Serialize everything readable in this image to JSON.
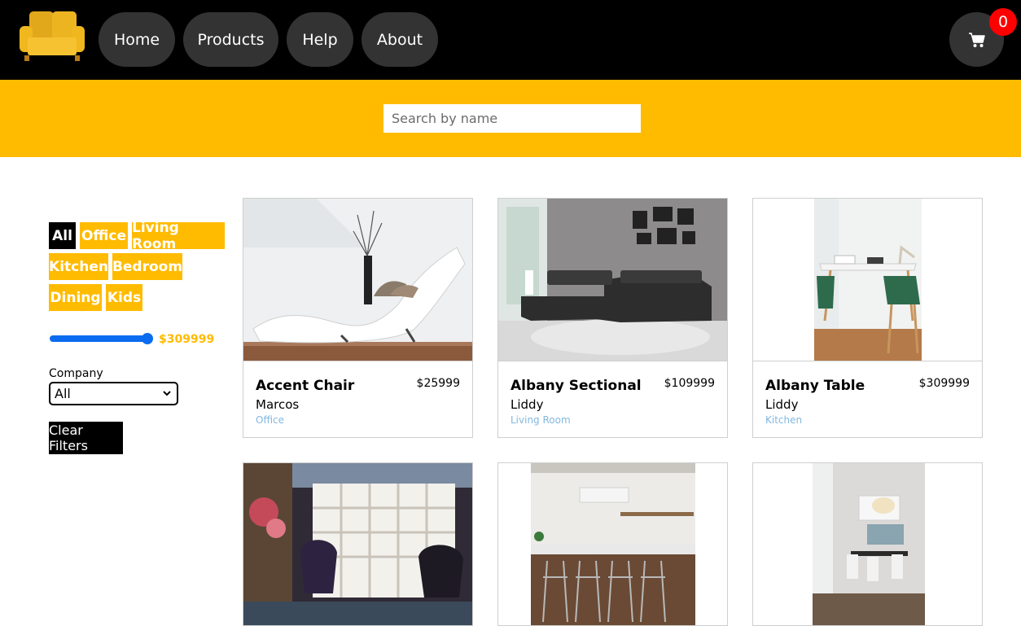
{
  "header": {
    "logo": "sofa-logo",
    "nav": [
      "Home",
      "Products",
      "Help",
      "About"
    ],
    "cart_count": "0"
  },
  "search": {
    "placeholder": "Search by name",
    "value": ""
  },
  "filters": {
    "categories": [
      "All",
      "Office",
      "Living Room",
      "Kitchen",
      "Bedroom",
      "Dining",
      "Kids"
    ],
    "active_category": "All",
    "price_label": "$309999",
    "price_fraction": 1.0,
    "company_label": "Company",
    "company_selected": "All",
    "clear_label": "Clear Filters"
  },
  "products": [
    {
      "name": "Accent Chair",
      "price": "$25999",
      "company": "Marcos",
      "category": "Office"
    },
    {
      "name": "Albany Sectional",
      "price": "$109999",
      "company": "Liddy",
      "category": "Living Room"
    },
    {
      "name": "Albany Table",
      "price": "$309999",
      "company": "Liddy",
      "category": "Kitchen"
    },
    {
      "name": "",
      "price": "",
      "company": "",
      "category": ""
    },
    {
      "name": "",
      "price": "",
      "company": "",
      "category": ""
    },
    {
      "name": "",
      "price": "",
      "company": "",
      "category": ""
    }
  ],
  "colors": {
    "accent": "#ffbb00",
    "header": "#000000",
    "nav_button": "#333333",
    "badge": "#ff0000",
    "slider": "#0b6cf0",
    "category_text": "#82b8e0"
  }
}
